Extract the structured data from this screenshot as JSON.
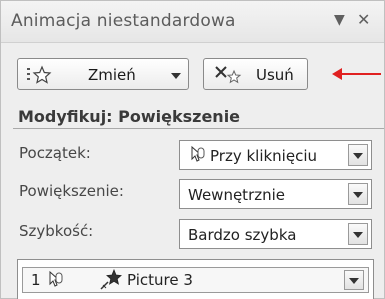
{
  "panel": {
    "title": "Animacja niestandardowa",
    "dropdown_glyph": "▼",
    "close_glyph": "✕"
  },
  "toolbar": {
    "change_label": "Zmień",
    "remove_label": "Usuń"
  },
  "modify": {
    "title": "Modyfikuj: Powiększenie",
    "start_label": "Początek:",
    "start_value": "Przy kliknięciu",
    "size_label": "Powiększenie:",
    "size_value": "Wewnętrznie",
    "speed_label": "Szybkość:",
    "speed_value": "Bardzo szybka"
  },
  "animation_list": {
    "items": [
      {
        "number": "1",
        "name": "Picture 3"
      }
    ]
  },
  "colors": {
    "annotation_arrow": "#e02020"
  }
}
